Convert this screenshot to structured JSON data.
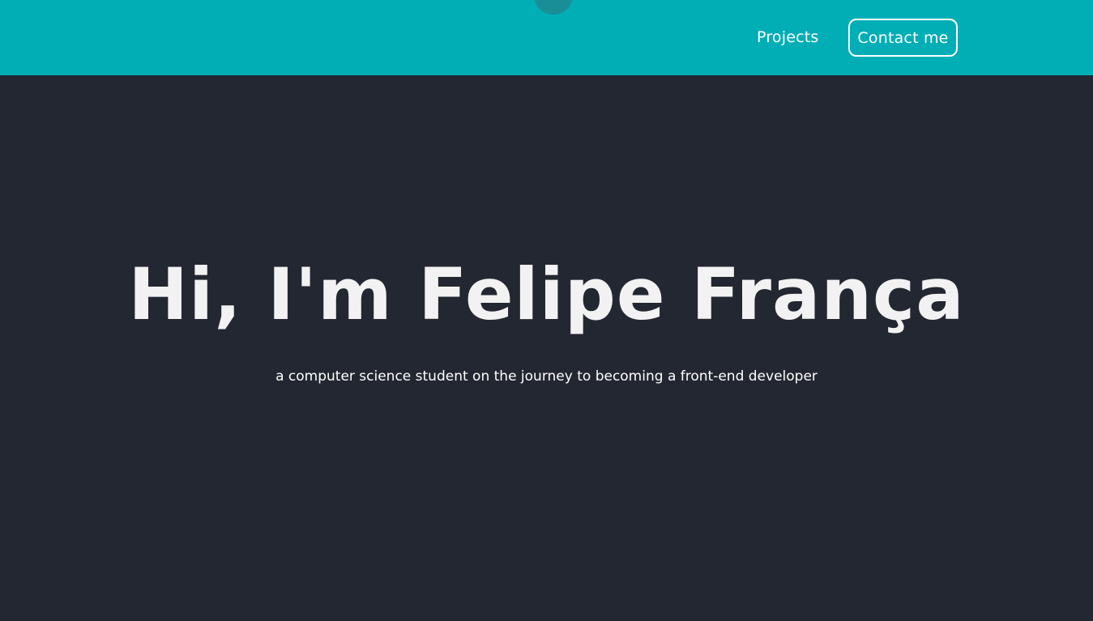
{
  "nav": {
    "links": [
      {
        "label": "Projects"
      }
    ],
    "contact_label": "Contact me"
  },
  "hero": {
    "title": "Hi, I'm Felipe França",
    "subtitle": "a computer science student on the journey to becoming a front-end developer"
  },
  "colors": {
    "navbar_bg": "#02aeb6",
    "page_bg": "#232731",
    "text": "#f2f2f2"
  }
}
